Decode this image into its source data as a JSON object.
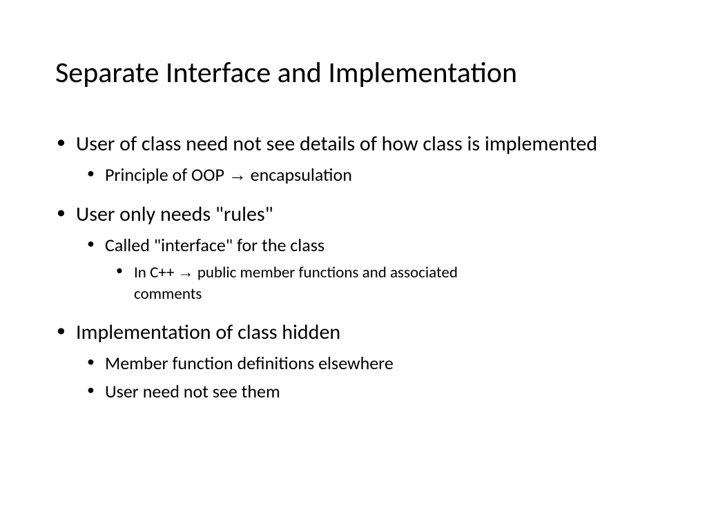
{
  "title": "Separate Interface and Implementation",
  "bullets": {
    "b1": "User of class need not see details of how class is implemented",
    "b1_1_pre": "Principle of OOP ",
    "b1_1_arrow": "→",
    "b1_1_post": " encapsulation",
    "b2": "User only needs \"rules\"",
    "b2_1": "Called \"interface\" for the class",
    "b2_1_1_pre": "In C++ ",
    "b2_1_1_arrow": "→",
    "b2_1_1_post": " public member functions and associated comments",
    "b3": "Implementation of class hidden",
    "b3_1": "Member function definitions elsewhere",
    "b3_2": "User need not see them"
  }
}
